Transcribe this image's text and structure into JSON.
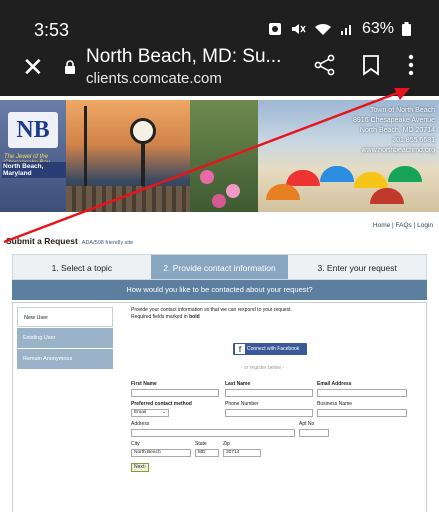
{
  "status_bar": {
    "time": "3:53",
    "battery": "63%"
  },
  "browser": {
    "page_title": "North Beach, MD: Su...",
    "url": "clients.comcate.com"
  },
  "banner": {
    "logo_text": "NB",
    "tagline": "The Jewel of the Chesapeake Bay",
    "place_name": "North Beach, Maryland",
    "address": [
      "Town of North Beach",
      "8916 Chesapeake Avenue",
      "North Beach, MD 20714",
      "301.855.6681",
      "www.northbeachmd.org"
    ]
  },
  "top_links": "Home | FAQs | Login",
  "submit": {
    "heading": "Submit a Request",
    "ada_link": "ADA/508 friendly site"
  },
  "steps": [
    {
      "label": "1. Select a topic"
    },
    {
      "label": "2. Provide contact information"
    },
    {
      "label": "3. Enter your request"
    }
  ],
  "how_bar": "How would you like to be contacted about your request?",
  "side_options": [
    {
      "label": "New User"
    },
    {
      "label": "Existing User"
    },
    {
      "label": "Remain Anonymous"
    }
  ],
  "form": {
    "intro_line1": "Provide your contact information so that we can respond to your request.",
    "intro_line2_prefix": "Required fields marked in ",
    "intro_line2_bold": "bold",
    "facebook_button": "Connect with Facebook",
    "or_register": "- or register below -",
    "first_name_label": "First Name",
    "last_name_label": "Last Name",
    "email_label": "Email Address",
    "preferred_label": "Preferred contact method",
    "preferred_value": "Email",
    "phone_label": "Phone Number",
    "business_label": "Business Name",
    "address_label": "Address",
    "apt_label": "Apt No",
    "city_label": "City",
    "city_value": "North Beach",
    "state_label": "State",
    "state_value": "MD",
    "zip_label": "Zip",
    "zip_value": "20714",
    "next_button": "Next›"
  }
}
